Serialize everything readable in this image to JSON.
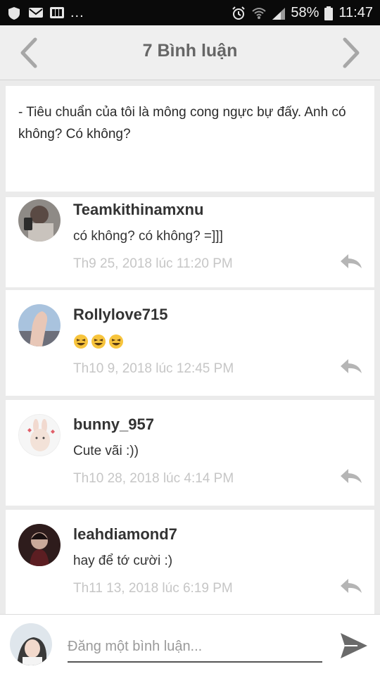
{
  "status_bar": {
    "left_icons": [
      "shield-icon",
      "mail-icon",
      "gallery-icon"
    ],
    "overflow": "...",
    "right_icons": [
      "alarm-icon",
      "wifi-icon",
      "signal-icon",
      "battery-icon"
    ],
    "battery": "58%",
    "time": "11:47"
  },
  "header": {
    "title": "7 Bình luận",
    "back_icon": "chevron-left-icon",
    "next_icon": "chevron-right-icon"
  },
  "post": {
    "text": "- Tiêu chuẩn của tôi là mông cong ngực bự đấy. Anh có không? Có không?"
  },
  "comments": [
    {
      "user": "Teamkithinamxnu",
      "text": "có không? có không? =]]]",
      "time": "Th9 25, 2018 lúc 11:20 PM"
    },
    {
      "user": "Rollylove715",
      "text": "",
      "emojis": [
        "laughing-emoji",
        "laughing-emoji",
        "laughing-emoji"
      ],
      "time": "Th10 9, 2018 lúc 12:45 PM"
    },
    {
      "user": "bunny_957",
      "text": "Cute vãi :))",
      "time": "Th10 28, 2018 lúc 4:14 PM"
    },
    {
      "user": "leahdiamond7",
      "text": "hay để tớ cười :)",
      "time": "Th11 13, 2018 lúc 6:19 PM"
    }
  ],
  "composer": {
    "placeholder": "Đăng một bình luận...",
    "value": "",
    "send_icon": "send-icon"
  },
  "colors": {
    "status_bar_bg": "#0a0a0a",
    "header_bg": "#efefef",
    "page_bg": "#ebebeb",
    "timestamp": "#c6c6c6",
    "icon_gray": "#b5b5b5"
  }
}
